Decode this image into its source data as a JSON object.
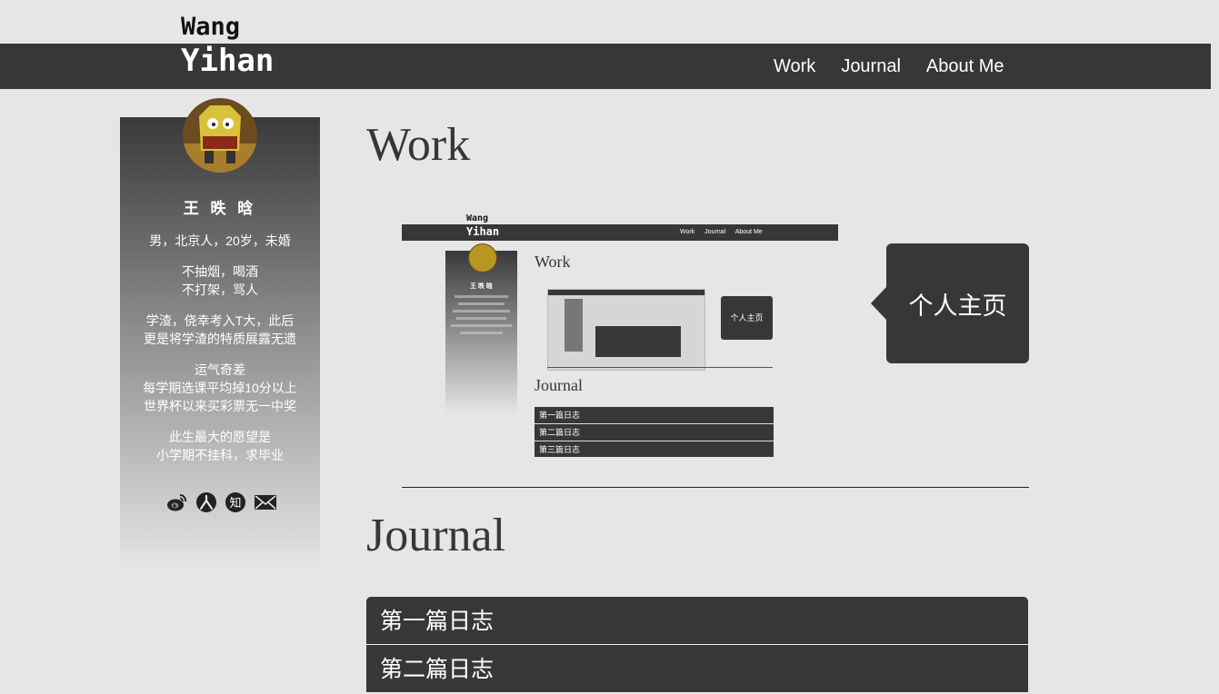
{
  "brand": {
    "line1": "Wang",
    "line2": "Yihan"
  },
  "nav": {
    "work": "Work",
    "journal": "Journal",
    "about": "About Me"
  },
  "sidebar": {
    "name": "王 昳 晗",
    "bio1": "男，北京人，20岁，未婚",
    "bio2a": "不抽烟，喝酒",
    "bio2b": "不打架，骂人",
    "bio3a": "学渣，侥幸考入T大，此后",
    "bio3b": "更是将学渣的特质展露无遗",
    "bio4a": "运气奇差",
    "bio4b": "每学期选课平均掉10分以上",
    "bio4c": "世界杯以来买彩票无一中奖",
    "bio5a": "此生最大的愿望是",
    "bio5b": "小学期不挂科，求毕业",
    "icons": [
      "weibo-icon",
      "renren-icon",
      "zhihu-icon",
      "mail-icon"
    ],
    "zhihu_glyph": "知"
  },
  "work": {
    "heading": "Work",
    "callout": "个人主页"
  },
  "journal": {
    "heading": "Journal",
    "items": [
      "第一篇日志",
      "第二篇日志"
    ]
  },
  "preview": {
    "brand1": "Wang",
    "brand2": "Yihan",
    "nav_work": "Work",
    "nav_journal": "Journal",
    "nav_about": "About Me",
    "name": "王 昳 晗",
    "work_heading": "Work",
    "journal_heading": "Journal",
    "callout": "个人主页",
    "items": [
      "第一篇日志",
      "第二篇日志",
      "第三篇日志"
    ]
  },
  "colors": {
    "dark": "#373737",
    "background": "#e6e6e6",
    "text_light": "#ffffff"
  }
}
